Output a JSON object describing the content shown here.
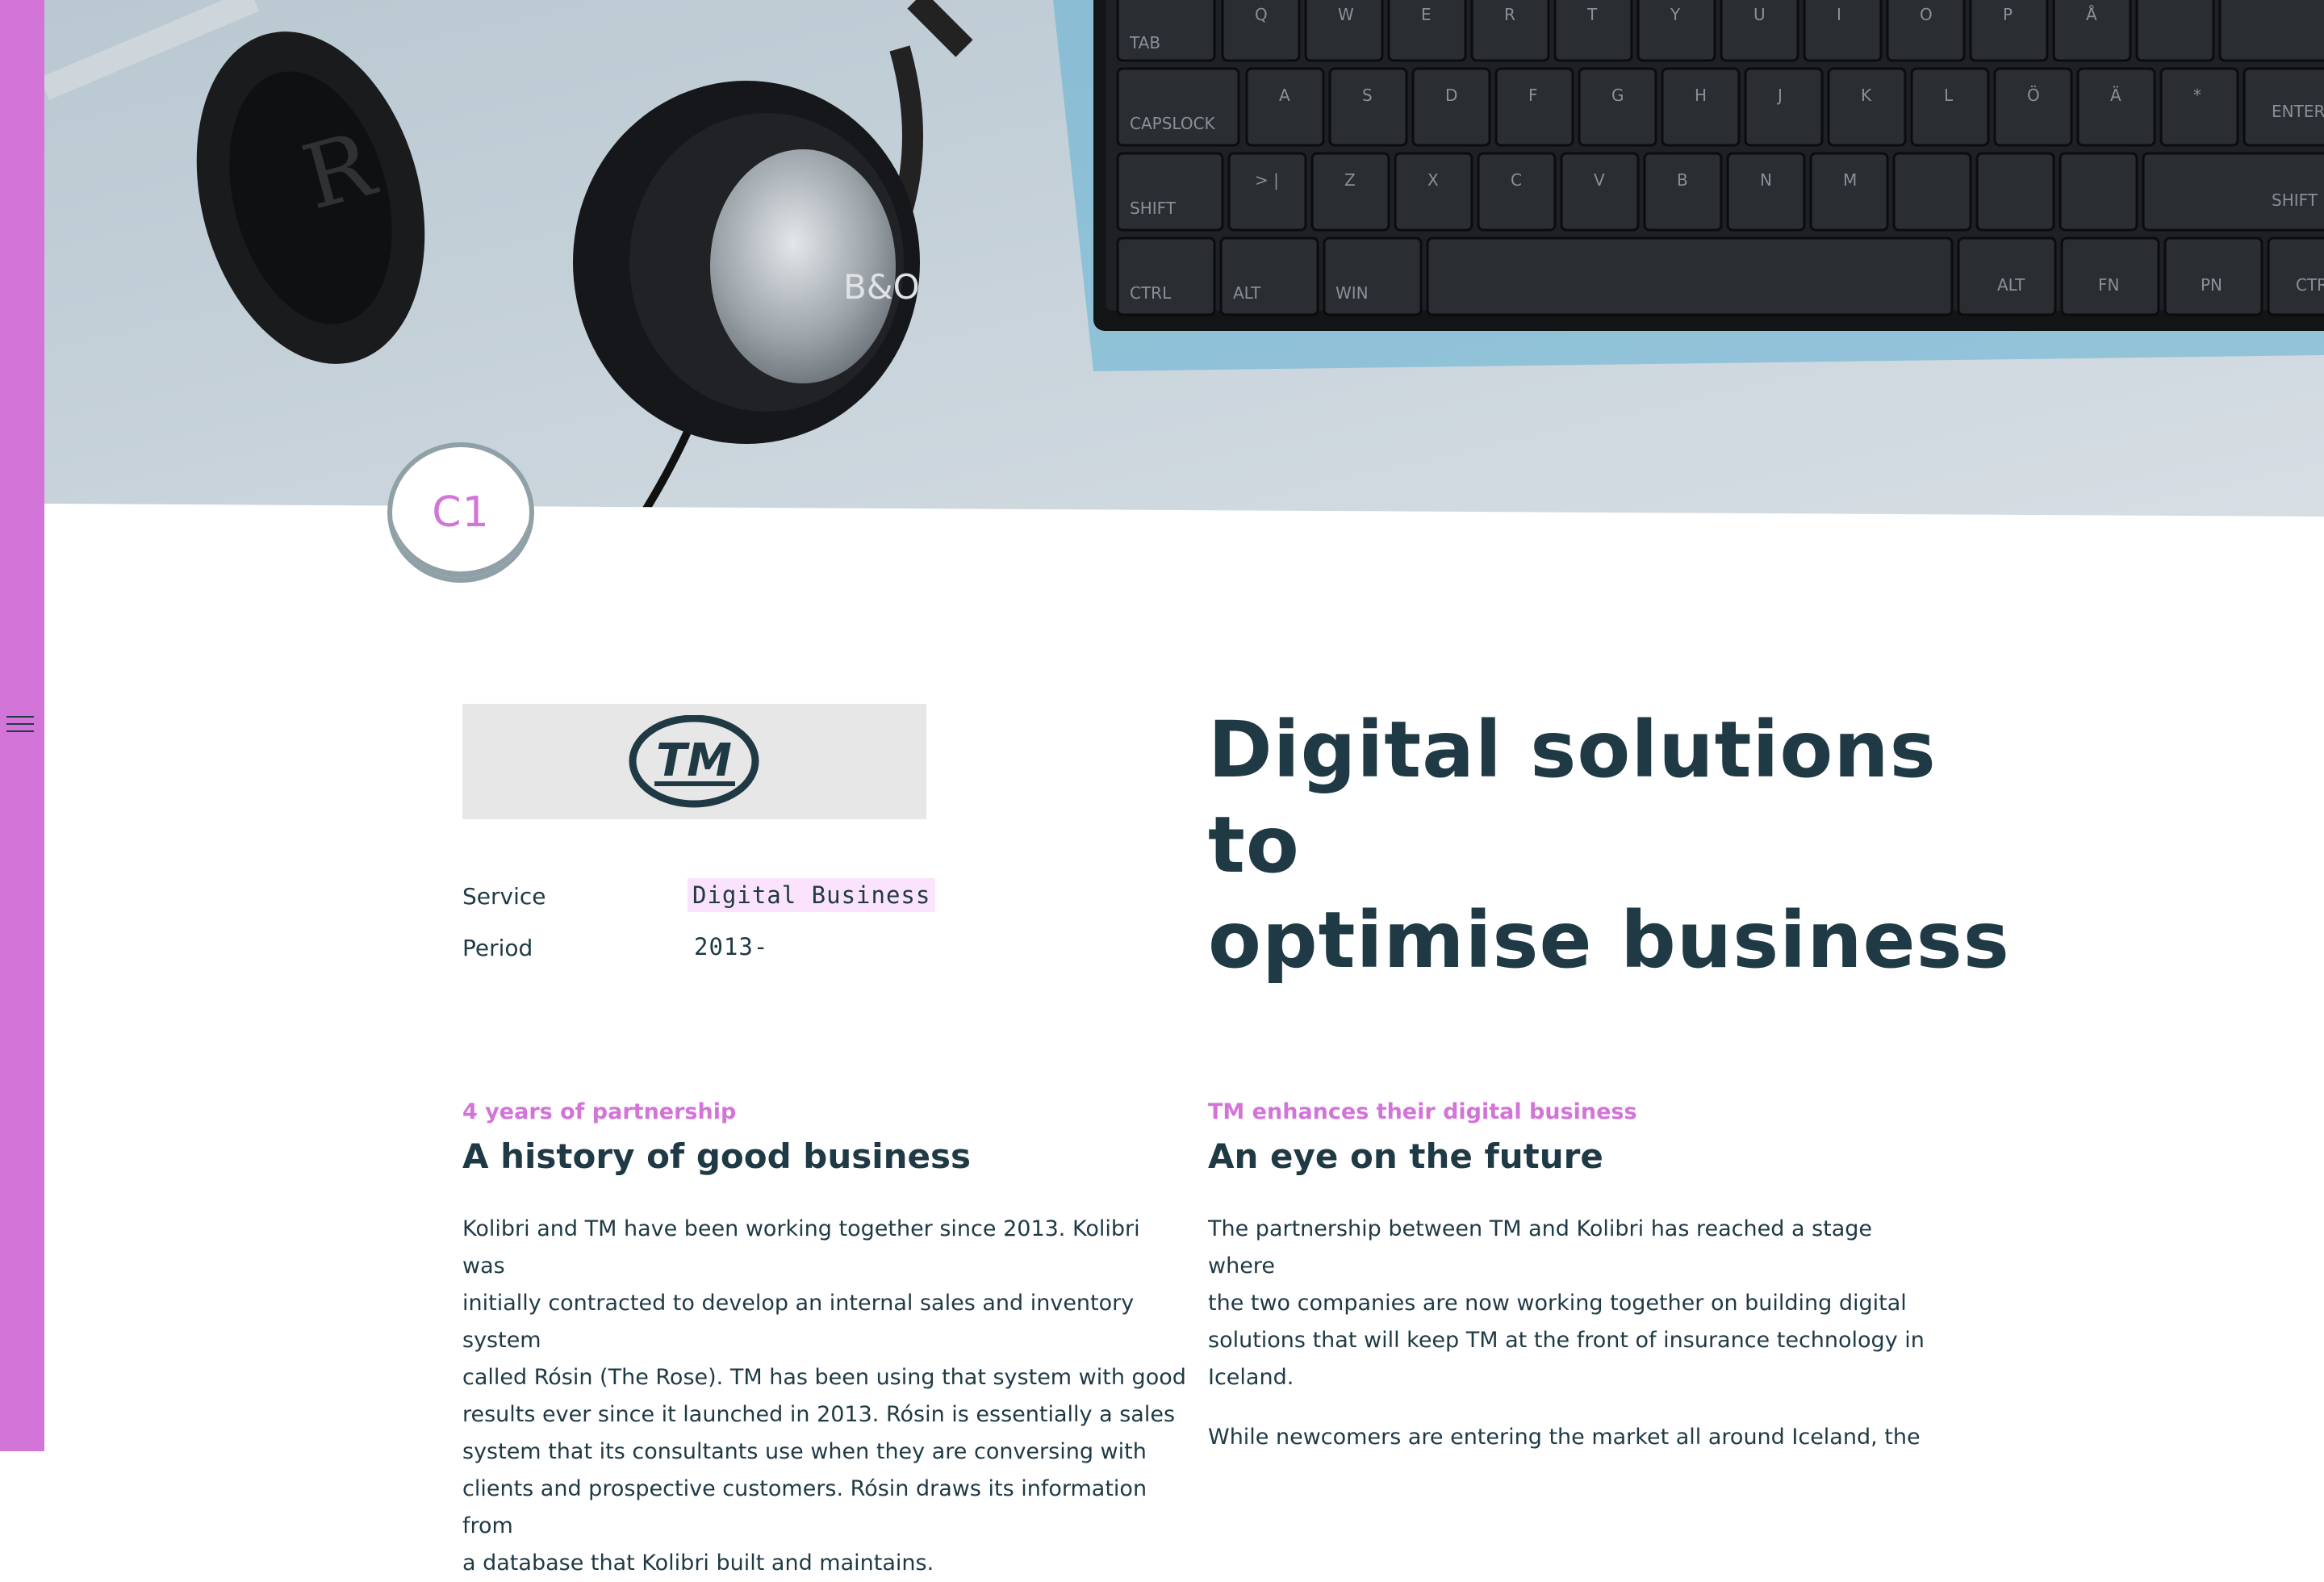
{
  "sidebar": {
    "accent": "#d274d8",
    "menu_icon": "hamburger-icon"
  },
  "hero": {
    "keyboard_keys_row1": [
      "Tab",
      "Q",
      "W",
      "E",
      "R",
      "T",
      "Y",
      "U",
      "I",
      "O",
      "P",
      "Å"
    ],
    "keyboard_keys_row2": [
      "Capslock",
      "A",
      "S",
      "D",
      "F",
      "G",
      "H",
      "J",
      "K",
      "L",
      "Ö",
      "Ä",
      "*",
      "Enter"
    ],
    "keyboard_keys_row3": [
      "Shift",
      "> <",
      "Z",
      "X",
      "C",
      "V",
      "B",
      "N",
      "M",
      "Shift"
    ],
    "keyboard_keys_row4": [
      "Ctrl",
      "Alt",
      "Win",
      "Alt",
      "Fn",
      "Pn",
      "Ctrl"
    ],
    "headphone_brand": "R",
    "earcup_logo": "B&O"
  },
  "badge": {
    "text": "C1"
  },
  "client": {
    "logo_text": "TM"
  },
  "info": {
    "service_label": "Service",
    "service_value": "Digital Business",
    "period_label": "Period",
    "period_value": "2013-"
  },
  "main_heading": {
    "line1": "Digital solutions to",
    "line2": "optimise business"
  },
  "left_section": {
    "eyebrow": "4 years of partnership",
    "title": "A history of good business",
    "body": [
      "Kolibri and TM have been working together since 2013. Kolibri was",
      "initially contracted to develop an internal sales and inventory system",
      "called Rósin (The Rose). TM has been using that system with good",
      "results ever since it launched in 2013. Rósin is essentially a sales",
      "system that its consultants use when they are conversing with",
      "clients and prospective customers. Rósin draws its information from",
      "a database that Kolibri built and maintains."
    ]
  },
  "right_section": {
    "eyebrow": "TM enhances their digital business",
    "title": "An eye on the future",
    "body": [
      "The partnership between TM and Kolibri has reached a stage where",
      "the two companies are now working together on building digital",
      "solutions that will keep TM at the front of insurance technology in",
      "Iceland."
    ],
    "body2": "While newcomers are entering the market all around Iceland, the"
  }
}
